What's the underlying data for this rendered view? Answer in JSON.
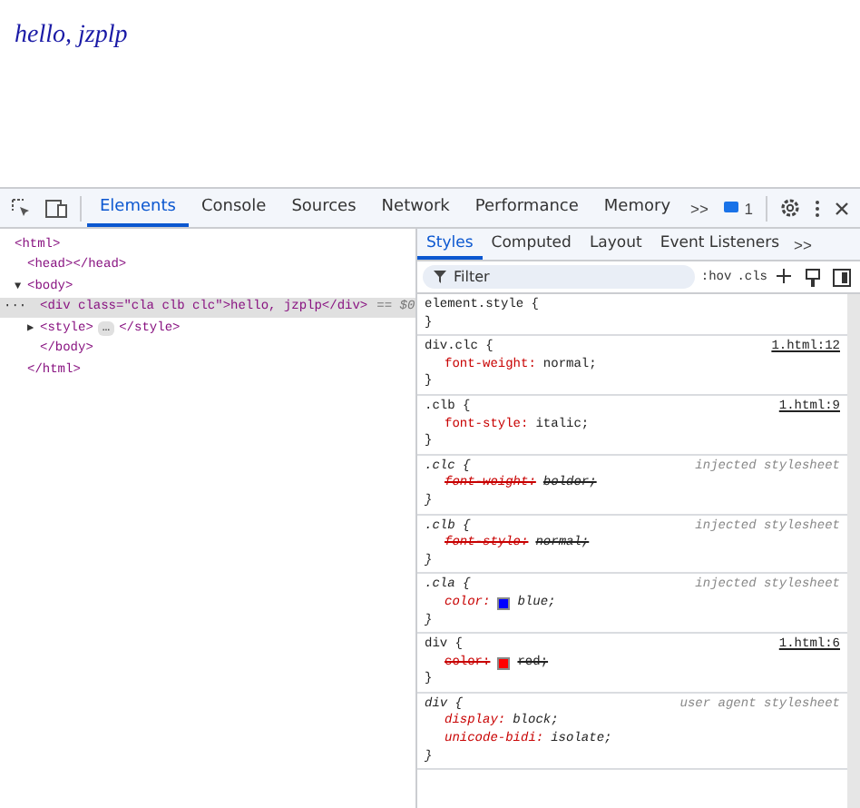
{
  "page": {
    "text": "hello, jzplp"
  },
  "toolbar": {
    "tabs": [
      {
        "label": "Elements",
        "selected": true
      },
      {
        "label": "Console",
        "selected": false
      },
      {
        "label": "Sources",
        "selected": false
      },
      {
        "label": "Network",
        "selected": false
      },
      {
        "label": "Performance",
        "selected": false
      },
      {
        "label": "Memory",
        "selected": false
      }
    ],
    "more": ">>",
    "issues_count": "1"
  },
  "dom_tree": [
    {
      "text": "<html>",
      "selected": false,
      "children": [
        {
          "text": "<head></head>",
          "selected": false
        },
        {
          "text": "<body>",
          "toggle": "▼",
          "selected": false,
          "children": [
            {
              "text": "<div class=\"cla clb clc\">hello, jzplp</div>",
              "gutter": "···",
              "suffix": "== $0",
              "selected": true
            },
            {
              "text": "<style>",
              "toggle": "▶",
              "end": "</style>",
              "collapsed_badge": "…",
              "selected": false
            },
            {
              "text": "</body>",
              "selected": false
            }
          ]
        },
        {
          "text": "</html>",
          "selected": false
        }
      ]
    }
  ],
  "styles_pane": {
    "tabs": [
      {
        "label": "Styles",
        "selected": true
      },
      {
        "label": "Computed",
        "selected": false
      },
      {
        "label": "Layout",
        "selected": false
      },
      {
        "label": "Event Listeners",
        "selected": false
      }
    ],
    "more": ">>",
    "filter": {
      "placeholder": "Filter"
    },
    "hov": ":hov",
    "cls": ".cls",
    "rules": [
      {
        "selector": "element.style {",
        "kind": "inline",
        "close": "}"
      },
      {
        "selector": "div.clc {",
        "source": "1.html:12",
        "kind": "file",
        "props": [
          {
            "name": "font-weight:",
            "value": "normal;",
            "overridden": false
          }
        ],
        "close": "}"
      },
      {
        "selector": ".clb {",
        "source": "1.html:9",
        "kind": "file",
        "props": [
          {
            "name": "font-style:",
            "value": "italic;",
            "overridden": false
          }
        ],
        "close": "}"
      },
      {
        "selector": ".clc {",
        "source": "injected stylesheet",
        "kind": "injected",
        "props": [
          {
            "name": "font-weight:",
            "value": "bolder;",
            "overridden": true
          }
        ],
        "close": "}"
      },
      {
        "selector": ".clb {",
        "source": "injected stylesheet",
        "kind": "injected",
        "props": [
          {
            "name": "font-style:",
            "value": "normal;",
            "overridden": true
          }
        ],
        "close": "}"
      },
      {
        "selector": ".cla {",
        "source": "injected stylesheet",
        "kind": "injected",
        "props": [
          {
            "name": "color:",
            "value": "blue;",
            "overridden": false,
            "color": "#0000ff"
          }
        ],
        "close": "}"
      },
      {
        "selector": "div {",
        "source": "1.html:6",
        "kind": "file",
        "props": [
          {
            "name": "color:",
            "value": "red;",
            "overridden": true,
            "color": "#ff0000"
          }
        ],
        "close": "}"
      },
      {
        "selector": "div {",
        "source": "user agent stylesheet",
        "kind": "injected",
        "props": [
          {
            "name": "display:",
            "value": "block;",
            "overridden": false
          },
          {
            "name": "unicode-bidi:",
            "value": "isolate;",
            "overridden": false
          }
        ],
        "close": "}"
      }
    ]
  }
}
